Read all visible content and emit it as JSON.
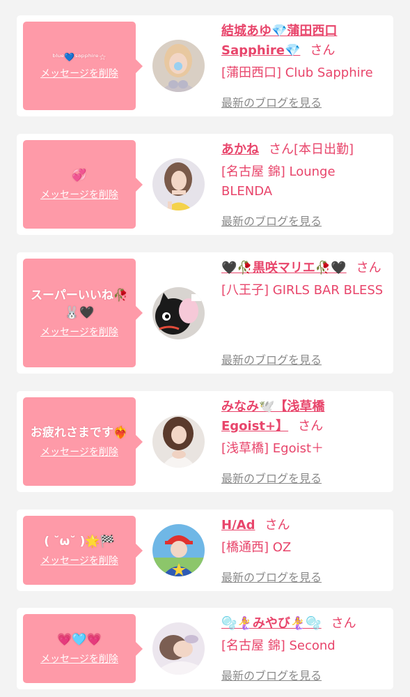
{
  "delete_label": "メッセージを削除",
  "san_label": "さん",
  "blog_label": "最新のブログを見る",
  "colors": {
    "bubble": "#fe9aa8",
    "name": "#e8456b",
    "link_gray": "#8a8a8a",
    "background": "#f3f3f3"
  },
  "cards": [
    {
      "message": "ᵇˡᵘᵉ💙ˢᵃᵖᵖʰⁱʳᵉ☆",
      "name": "結城あゆ💎蒲田西口Sapphire💎",
      "suffix": "",
      "shop": "[蒲田西口] Club Sapphire",
      "avatar_icon": "woman-photo-icon"
    },
    {
      "message": "💞",
      "name": "あかね",
      "suffix": "[本日出勤]",
      "shop": "[名古屋 錦] Lounge BLENDA",
      "avatar_icon": "woman-photo-icon"
    },
    {
      "message": "スーパーいいね🥀🐰🖤",
      "name": "🖤🥀黒咲マリエ🥀🖤",
      "suffix": "",
      "shop": "[八王子] GIRLS BAR BLESS",
      "avatar_icon": "cat-photo-icon"
    },
    {
      "message": "お疲れさまです❤️‍🔥",
      "name": "みなみ🕊️【浅草橋Egoist+】",
      "suffix": "",
      "shop": "[浅草橋] Egoist＋",
      "avatar_icon": "woman-photo-icon"
    },
    {
      "message": "( ˘ω˘ )🌟🏁",
      "name": "H/Ad",
      "suffix": "",
      "shop": "[橋通西] OZ",
      "avatar_icon": "costume-photo-icon"
    },
    {
      "message": "💗🩵💗",
      "name": "🫧🧜‍♀️みやび🧜‍♀️🫧",
      "suffix": "",
      "shop": "[名古屋 錦] Second",
      "avatar_icon": "woman-photo-icon"
    }
  ]
}
